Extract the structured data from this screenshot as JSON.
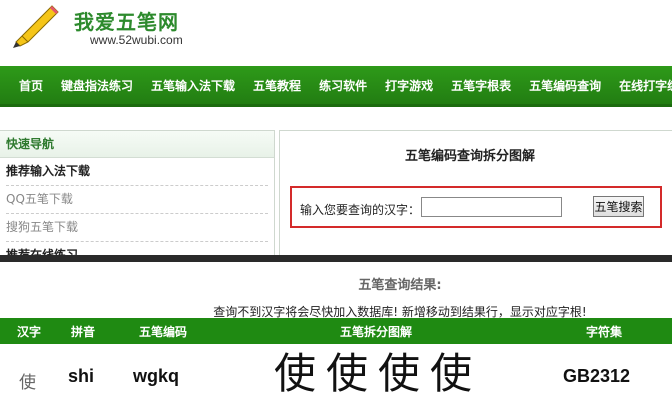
{
  "header": {
    "title": "我爱五笔网",
    "url": "www.52wubi.com"
  },
  "nav": [
    "首页",
    "键盘指法练习",
    "五笔输入法下载",
    "五笔教程",
    "练习软件",
    "打字游戏",
    "五笔字根表",
    "五笔编码查询",
    "在线打字练"
  ],
  "sidebar": {
    "title": "快速导航",
    "links": [
      "推荐输入法下载",
      "QQ五笔下载",
      "搜狗五笔下载",
      "推荐在线练习"
    ]
  },
  "panel": {
    "title": "五笔编码查询拆分图解",
    "search_label": "输入您要查询的汉字：",
    "search_value": "",
    "search_button": "五笔搜索"
  },
  "results": {
    "heading": "五笔查询结果:",
    "notice": "查询不到汉字将会尽快加入数据库! 新增移动到结果行，显示对应字根!",
    "columns": [
      "汉字",
      "拼音",
      "五笔编码",
      "五笔拆分图解",
      "字符集"
    ],
    "row": {
      "char": "使",
      "pinyin": "shi",
      "code": "wgkq",
      "decomposition": [
        "使",
        "使",
        "使",
        "使"
      ],
      "charset": "GB2312"
    }
  },
  "colors": {
    "brand_green": "#1f8a12",
    "title_green": "#2d8a2d",
    "highlight_red": "#d42a2a"
  },
  "icons": [
    "pencil-logo-icon"
  ]
}
